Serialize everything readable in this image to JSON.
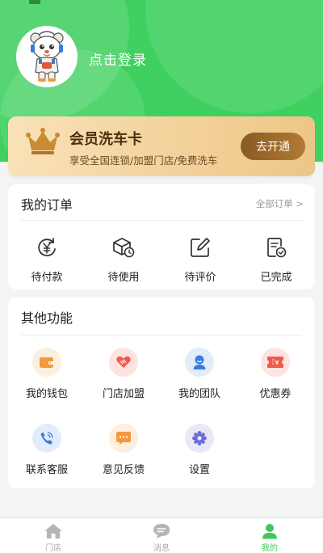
{
  "profile": {
    "login_text": "点击登录"
  },
  "vip": {
    "title": "会员洗车卡",
    "subtitle": "享受全国连锁/加盟门店/免费洗车",
    "button": "去开通"
  },
  "orders": {
    "title": "我的订单",
    "all_link": "全部订单 >",
    "items": [
      {
        "label": "待付款",
        "icon": "yen-coin-icon"
      },
      {
        "label": "待使用",
        "icon": "package-clock-icon"
      },
      {
        "label": "待评价",
        "icon": "edit-pencil-icon"
      },
      {
        "label": "已完成",
        "icon": "document-check-icon"
      }
    ]
  },
  "functions": {
    "title": "其他功能",
    "items": [
      {
        "label": "我的钱包",
        "icon": "wallet-icon",
        "color": "#f39a3a"
      },
      {
        "label": "门店加盟",
        "icon": "handshake-icon",
        "color": "#ef5a4a"
      },
      {
        "label": "我的团队",
        "icon": "team-user-icon",
        "color": "#3a7be0"
      },
      {
        "label": "优惠券",
        "icon": "coupon-icon",
        "color": "#ef5a4a"
      },
      {
        "label": "联系客服",
        "icon": "phone-icon",
        "color": "#3a7be0"
      },
      {
        "label": "意见反馈",
        "icon": "feedback-icon",
        "color": "#f39a3a"
      },
      {
        "label": "设置",
        "icon": "settings-gear-icon",
        "color": "#6a6ad8"
      }
    ]
  },
  "tabbar": {
    "items": [
      {
        "label": "门店",
        "icon": "home-icon"
      },
      {
        "label": "消息",
        "icon": "message-icon"
      },
      {
        "label": "我的",
        "icon": "profile-icon"
      }
    ],
    "active": "我的",
    "active_color": "#3cc85a"
  },
  "colors": {
    "header_green": "#3fd05f",
    "vip_gold": "#f3d29b",
    "vip_button": "#9a6a2a"
  }
}
